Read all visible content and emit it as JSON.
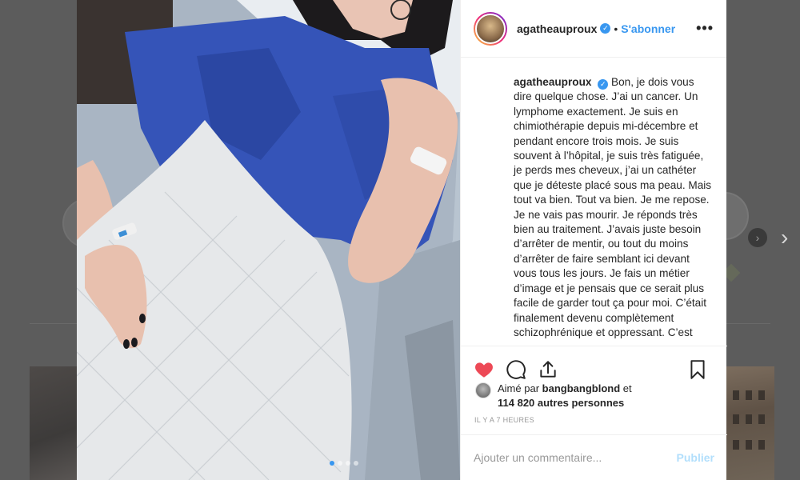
{
  "post": {
    "username": "agatheauproux",
    "follow_label": "S'abonner",
    "more_icon": "more-horizontal-icon",
    "caption_text": "Bon, je dois vous dire quelque chose. J’ai un cancer. Un lymphome exactement. Je suis en chimiothérapie depuis mi-décembre et pendant encore trois mois. Je suis souvent à l’hôpital, je suis très fatiguée, je perds mes cheveux, j’ai un cathéter que je déteste placé sous ma peau. Mais tout va bien. Tout va bien. Je me repose. Je ne vais pas mourir. Je réponds très bien au traitement. J’avais juste besoin d’arrêter de mentir, ou tout du moins d’arrêter de faire semblant ici devant vous tous les jours. Je fais un métier d’image et je pensais que ce serait plus facile de garder tout ça pour moi. C’était finalement devenu complètement schizophrénique et oppressant. C’est",
    "likes_prefix": "Aimé par",
    "liked_by": "bangbangblond",
    "likes_and": "et",
    "likes_count": "114 820 autres personnes",
    "time_ago": "IL Y A 7 HEURES",
    "comment_placeholder": "Ajouter un commentaire...",
    "publish_label": "Publier",
    "carousel": {
      "count": 4,
      "active_index": 0
    }
  },
  "colors": {
    "accent": "#3897f0",
    "like_red": "#ed4956",
    "publish_disabled": "#b2dffc"
  },
  "icons": [
    "heart-icon",
    "comment-icon",
    "share-icon",
    "bookmark-icon",
    "verified-badge-icon",
    "chevron-right-icon"
  ]
}
